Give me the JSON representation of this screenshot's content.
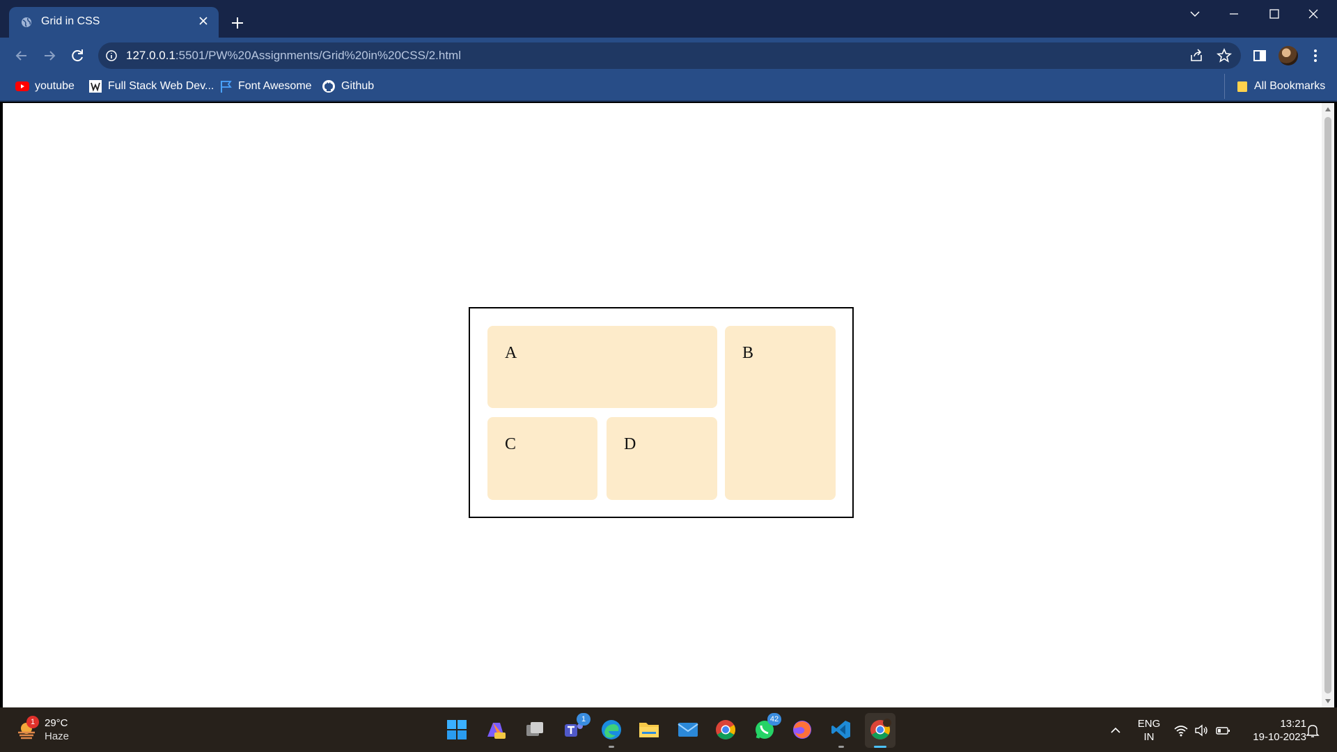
{
  "browser": {
    "tab": {
      "title": "Grid in CSS",
      "favicon": "globe-icon"
    },
    "url": {
      "host": "127.0.0.1",
      "path": ":5501/PW%20Assignments/Grid%20in%20CSS/2.html"
    },
    "bookmarks": [
      {
        "label": "youtube",
        "icon": "youtube-icon"
      },
      {
        "label": "Full Stack Web Dev...",
        "icon": "site-icon"
      },
      {
        "label": "Font Awesome",
        "icon": "flag-icon"
      },
      {
        "label": "Github",
        "icon": "github-icon"
      }
    ],
    "all_bookmarks": "All Bookmarks"
  },
  "page": {
    "cells": {
      "a": "A",
      "b": "B",
      "c": "C",
      "d": "D"
    },
    "colors": {
      "cell_bg": "#fdebca",
      "border": "#000000"
    }
  },
  "taskbar": {
    "weather": {
      "temp": "29°C",
      "condition": "Haze",
      "badge": "1"
    },
    "apps": [
      {
        "name": "windows-start",
        "badge": ""
      },
      {
        "name": "copilot-pre",
        "badge": ""
      },
      {
        "name": "task-view",
        "badge": ""
      },
      {
        "name": "teams",
        "badge": "1"
      },
      {
        "name": "edge",
        "badge": ""
      },
      {
        "name": "file-explorer",
        "badge": ""
      },
      {
        "name": "mail",
        "badge": ""
      },
      {
        "name": "chrome",
        "badge": ""
      },
      {
        "name": "whatsapp",
        "badge": "42"
      },
      {
        "name": "firefox",
        "badge": ""
      },
      {
        "name": "vscode",
        "badge": ""
      },
      {
        "name": "chrome-profile",
        "badge": ""
      }
    ],
    "lang": {
      "line1": "ENG",
      "line2": "IN"
    },
    "clock": {
      "time": "13:21",
      "date": "19-10-2023"
    }
  }
}
